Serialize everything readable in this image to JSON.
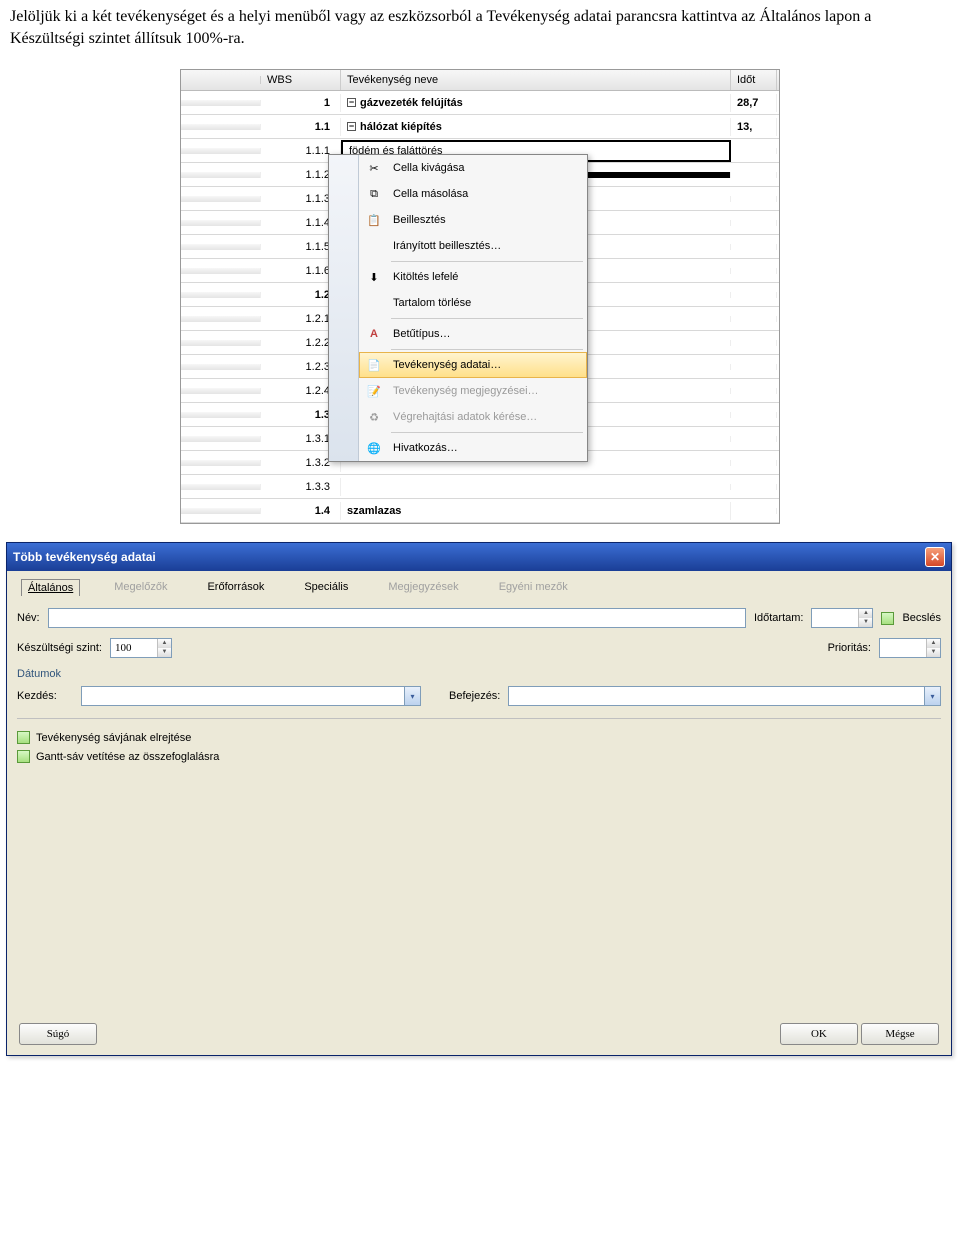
{
  "instruction": "Jelöljük ki a két tevékenységet és a helyi menüből vagy az eszközsorból a Tevékenység adatai parancsra kattintva az Általános lapon a Készültségi szintet állítsuk 100%-ra.",
  "table": {
    "headers": {
      "wbs": "WBS",
      "name": "Tevékenység neve",
      "dur": "Időt"
    },
    "rows": [
      {
        "wbs": "1",
        "name": "gázvezeték felújítás",
        "dur": "28,7",
        "bold": true,
        "expand": true
      },
      {
        "wbs": "1.1",
        "name": "hálózat kiépítés",
        "dur": "13,",
        "bold": true,
        "expand": true
      },
      {
        "wbs": "1.1.1",
        "name": "födém és faláttörés",
        "dur": "",
        "sel": "first"
      },
      {
        "wbs": "1.1.2",
        "name": "",
        "dur": "",
        "sel": "row"
      },
      {
        "wbs": "1.1.3",
        "name": "",
        "dur": ""
      },
      {
        "wbs": "1.1.4",
        "name": "",
        "dur": ""
      },
      {
        "wbs": "1.1.5",
        "name": "",
        "dur": ""
      },
      {
        "wbs": "1.1.6",
        "name": "",
        "dur": ""
      },
      {
        "wbs": "1.2",
        "name": "",
        "dur": "",
        "bold": true
      },
      {
        "wbs": "1.2.1",
        "name": "",
        "dur": ""
      },
      {
        "wbs": "1.2.2",
        "name": "",
        "dur": ""
      },
      {
        "wbs": "1.2.3",
        "name": "",
        "dur": ""
      },
      {
        "wbs": "1.2.4",
        "name": "",
        "dur": ""
      },
      {
        "wbs": "1.3",
        "name": "",
        "dur": "",
        "bold": true
      },
      {
        "wbs": "1.3.1",
        "name": "",
        "dur": ""
      },
      {
        "wbs": "1.3.2",
        "name": "",
        "dur": ""
      },
      {
        "wbs": "1.3.3",
        "name": "",
        "dur": ""
      },
      {
        "wbs": "1.4",
        "name": "szamlazas",
        "dur": "",
        "bold": true
      }
    ]
  },
  "context_menu": {
    "cut": "Cella kivágása",
    "copy": "Cella másolása",
    "paste": "Beillesztés",
    "paste_spec": "Irányított beillesztés…",
    "fill_down": "Kitöltés lefelé",
    "clear": "Tartalom törlése",
    "font": "Betűtípus…",
    "task_info": "Tevékenység adatai…",
    "task_notes": "Tevékenység megjegyzései…",
    "exec_data": "Végrehajtási adatok kérése…",
    "hyperlink": "Hivatkozás…"
  },
  "dialog": {
    "title": "Több tevékenység adatai",
    "tabs": {
      "general": "Általános",
      "pred": "Megelőzők",
      "res": "Erőforrások",
      "spec": "Speciális",
      "notes": "Megjegyzések",
      "custom": "Egyéni mezők"
    },
    "labels": {
      "name": "Név:",
      "duration": "Időtartam:",
      "estimate": "Becslés",
      "percent": "Készültségi szint:",
      "priority": "Prioritás:",
      "dates": "Dátumok",
      "start": "Kezdés:",
      "finish": "Befejezés:",
      "hide_bar": "Tevékenység sávjának elrejtése",
      "rollup": "Gantt-sáv vetítése az összefoglalásra"
    },
    "values": {
      "percent": "100"
    },
    "buttons": {
      "help": "Súgó",
      "ok": "OK",
      "cancel": "Mégse"
    }
  }
}
